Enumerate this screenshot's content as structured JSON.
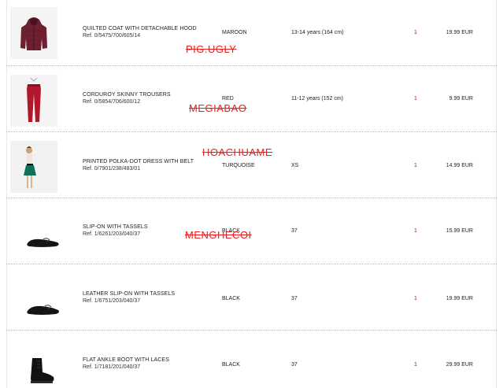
{
  "order": {
    "items": [
      {
        "name": "QUILTED COAT WITH DETACHABLE HOOD",
        "ref": "Ref. 0/5475/700/605/14",
        "color": "MAROON",
        "size": "13-14 years (164 cm)",
        "quantity": "1",
        "price": "19.99 EUR",
        "image_icon": "maroon-quilted-coat",
        "product_color_hex": "#6e1f30"
      },
      {
        "name": "CORDUROY SKINNY TROUSERS",
        "ref": "Ref. 0/5854/706/600/12",
        "color": "RED",
        "size": "11-12 years (152 cm)",
        "quantity": "1",
        "price": "9.99 EUR",
        "image_icon": "red-trousers",
        "product_color_hex": "#b3172b"
      },
      {
        "name": "PRINTED POLKA-DOT DRESS WITH BELT",
        "ref": "Ref. 0/7901/238/483/01",
        "color": "TURQUOISE",
        "size": "XS",
        "quantity": "1",
        "price": "14.99 EUR",
        "image_icon": "polka-dot-dress-model",
        "product_color_hex": "#11705a"
      },
      {
        "name": "SLIP-ON WITH TASSELS",
        "ref": "Ref. 1/6261/203/040/37",
        "color": "BLACK",
        "size": "37",
        "quantity": "1",
        "price": "15.99 EUR",
        "image_icon": "black-slip-on-shoe",
        "product_color_hex": "#111111"
      },
      {
        "name": "LEATHER SLIP-ON WITH TASSELS",
        "ref": "Ref. 1/6751/203/040/37",
        "color": "BLACK",
        "size": "37",
        "quantity": "1",
        "price": "19.99 EUR",
        "image_icon": "black-leather-slip-on",
        "product_color_hex": "#111111"
      },
      {
        "name": "FLAT ANKLE BOOT WITH LACES",
        "ref": "Ref. 1/7181/201/040/37",
        "color": "BLACK",
        "size": "37",
        "quantity": "1",
        "price": "29.99 EUR",
        "image_icon": "black-ankle-boot",
        "product_color_hex": "#111111"
      }
    ]
  },
  "overlays": [
    {
      "text": "PIG.UGLY",
      "color": "#ee1c1c"
    },
    {
      "text": "MEGIABAO",
      "color": "#ee1c1c"
    },
    {
      "text": "HOACHUAME",
      "color": "#ee1c1c"
    },
    {
      "text": "MENGHECOI",
      "color": "#ee1c1c"
    }
  ]
}
